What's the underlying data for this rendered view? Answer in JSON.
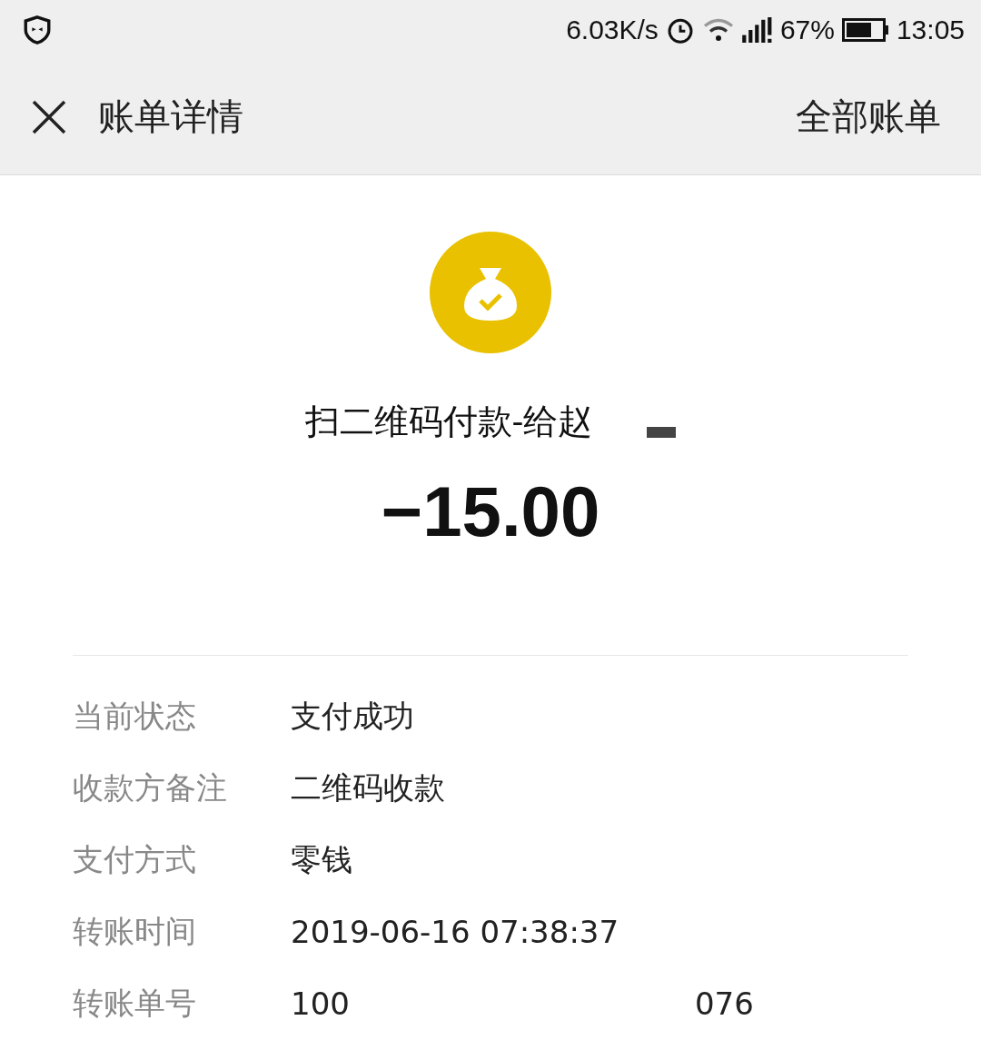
{
  "status_bar": {
    "speed": "6.03K/s",
    "battery": "67%",
    "time": "13:05"
  },
  "nav": {
    "title": "账单详情",
    "action": "全部账单"
  },
  "header": {
    "title": "扫二维码付款-给赵",
    "amount": "−15.00"
  },
  "details": [
    {
      "label": "当前状态",
      "value": "支付成功"
    },
    {
      "label": "收款方备注",
      "value": "二维码收款"
    },
    {
      "label": "支付方式",
      "value": "零钱"
    },
    {
      "label": "转账时间",
      "value": "2019-06-16 07:38:37"
    },
    {
      "label": "转账单号",
      "value": "100",
      "value_tail": "076"
    }
  ]
}
